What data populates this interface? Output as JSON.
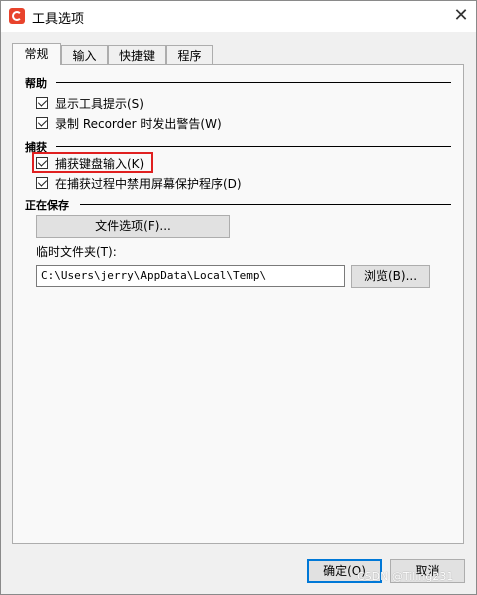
{
  "window": {
    "title": "工具选项",
    "close_glyph": "✕"
  },
  "tabs": [
    {
      "label": "常规",
      "active": true
    },
    {
      "label": "输入",
      "active": false
    },
    {
      "label": "快捷键",
      "active": false
    },
    {
      "label": "程序",
      "active": false
    }
  ],
  "help": {
    "heading": "帮助",
    "options": [
      {
        "label": "显示工具提示(S)",
        "checked": true
      },
      {
        "label": "录制 Recorder 时发出警告(W)",
        "checked": true
      }
    ]
  },
  "capture": {
    "heading": "捕获",
    "options": [
      {
        "label": "捕获键盘输入(K)",
        "checked": true,
        "highlighted": true
      },
      {
        "label": "在捕获过程中禁用屏幕保护程序(D)",
        "checked": true
      }
    ]
  },
  "saving": {
    "heading": "正在保存",
    "file_options_button": "文件选项(F)...",
    "temp_folder_label": "临时文件夹(T):",
    "temp_folder_value": "C:\\Users\\jerry\\AppData\\Local\\Temp\\",
    "browse_button": "浏览(B)..."
  },
  "footer": {
    "ok_button": "确定(O)",
    "cancel_button": "取消"
  },
  "watermark": "CSDN @Tiling231",
  "colors": {
    "app_icon": "#e8432c",
    "highlight": "#e02020",
    "default_button_border": "#0078d7"
  }
}
